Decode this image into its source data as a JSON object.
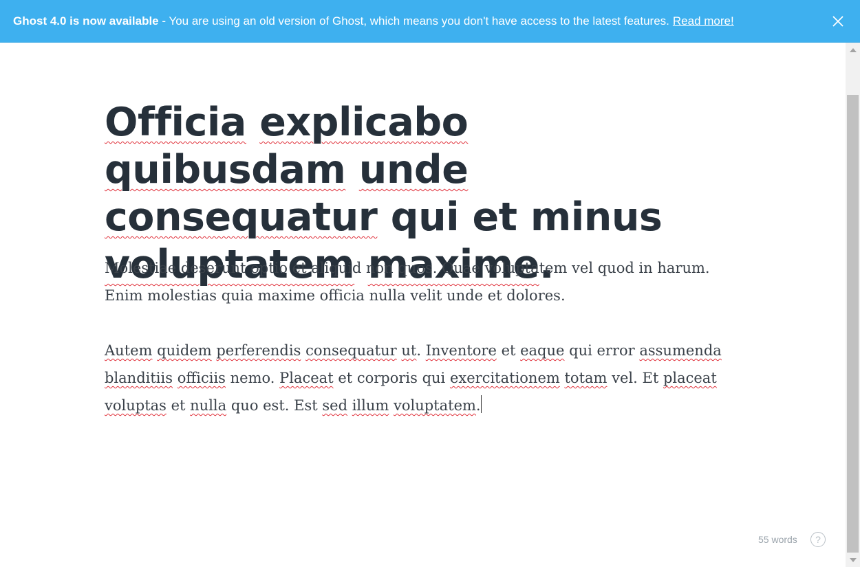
{
  "banner": {
    "strong_text": "Ghost 4.0 is now available",
    "message": " - You are using an old version of Ghost, which means you don't have access to the latest features.",
    "link_text": "Read more!",
    "icon": "close-icon",
    "color": "#3eb0ef"
  },
  "editor": {
    "title_words": [
      {
        "text": "Officia",
        "spell": true
      },
      {
        "text": "explicabo",
        "spell": true
      },
      {
        "text": "quibusdam",
        "spell": true
      },
      {
        "text": "unde",
        "spell": true
      },
      {
        "text": "consequatur",
        "spell": true
      },
      {
        "text": "qui",
        "spell": false
      },
      {
        "text": "et",
        "spell": false
      },
      {
        "text": "minus",
        "spell": false
      },
      {
        "text": "voluptatem",
        "spell": true
      },
      {
        "text": "maxime",
        "spell": true
      },
      {
        "text": ".",
        "spell": false
      }
    ],
    "paragraphs": [
      [
        {
          "text": "Molestiae deserunt optio et aliquid non quos. Quae voluptatem vel quod in harum. Enim molestias quia maxime officia nulla velit unde et dolores.",
          "spell": false
        }
      ],
      [
        {
          "text": "Autem",
          "spell": true
        },
        {
          "text": " ",
          "spell": false
        },
        {
          "text": "quidem",
          "spell": true
        },
        {
          "text": " ",
          "spell": false
        },
        {
          "text": "perferendis",
          "spell": true
        },
        {
          "text": " ",
          "spell": false
        },
        {
          "text": "consequatur",
          "spell": true
        },
        {
          "text": " ",
          "spell": false
        },
        {
          "text": "ut",
          "spell": true
        },
        {
          "text": ". ",
          "spell": false
        },
        {
          "text": "Inventore",
          "spell": true
        },
        {
          "text": " et ",
          "spell": false
        },
        {
          "text": "eaque",
          "spell": true
        },
        {
          "text": " qui error ",
          "spell": false
        },
        {
          "text": "assumenda",
          "spell": true
        },
        {
          "text": " ",
          "spell": false
        },
        {
          "text": "blanditiis",
          "spell": true
        },
        {
          "text": " ",
          "spell": false
        },
        {
          "text": "officiis",
          "spell": true
        },
        {
          "text": " nemo. ",
          "spell": false
        },
        {
          "text": "Placeat",
          "spell": true
        },
        {
          "text": " et corporis qui ",
          "spell": false
        },
        {
          "text": "exercitationem",
          "spell": true
        },
        {
          "text": " ",
          "spell": false
        },
        {
          "text": "totam",
          "spell": true
        },
        {
          "text": " vel. Et ",
          "spell": false
        },
        {
          "text": "placeat",
          "spell": true
        },
        {
          "text": " ",
          "spell": false
        },
        {
          "text": "voluptas",
          "spell": true
        },
        {
          "text": " et ",
          "spell": false
        },
        {
          "text": "nulla",
          "spell": true
        },
        {
          "text": " quo est. Est ",
          "spell": false
        },
        {
          "text": "sed",
          "spell": true
        },
        {
          "text": " ",
          "spell": false
        },
        {
          "text": "illum",
          "spell": true
        },
        {
          "text": " ",
          "spell": false
        },
        {
          "text": "voluptatem",
          "spell": true
        },
        {
          "text": ".",
          "spell": false
        }
      ]
    ],
    "word_count": "55 words",
    "help_label": "?",
    "help_icon": "help-circle-icon"
  },
  "scrollbar": {
    "icons": [
      "scroll-up-arrow-icon",
      "scroll-down-arrow-icon"
    ]
  }
}
